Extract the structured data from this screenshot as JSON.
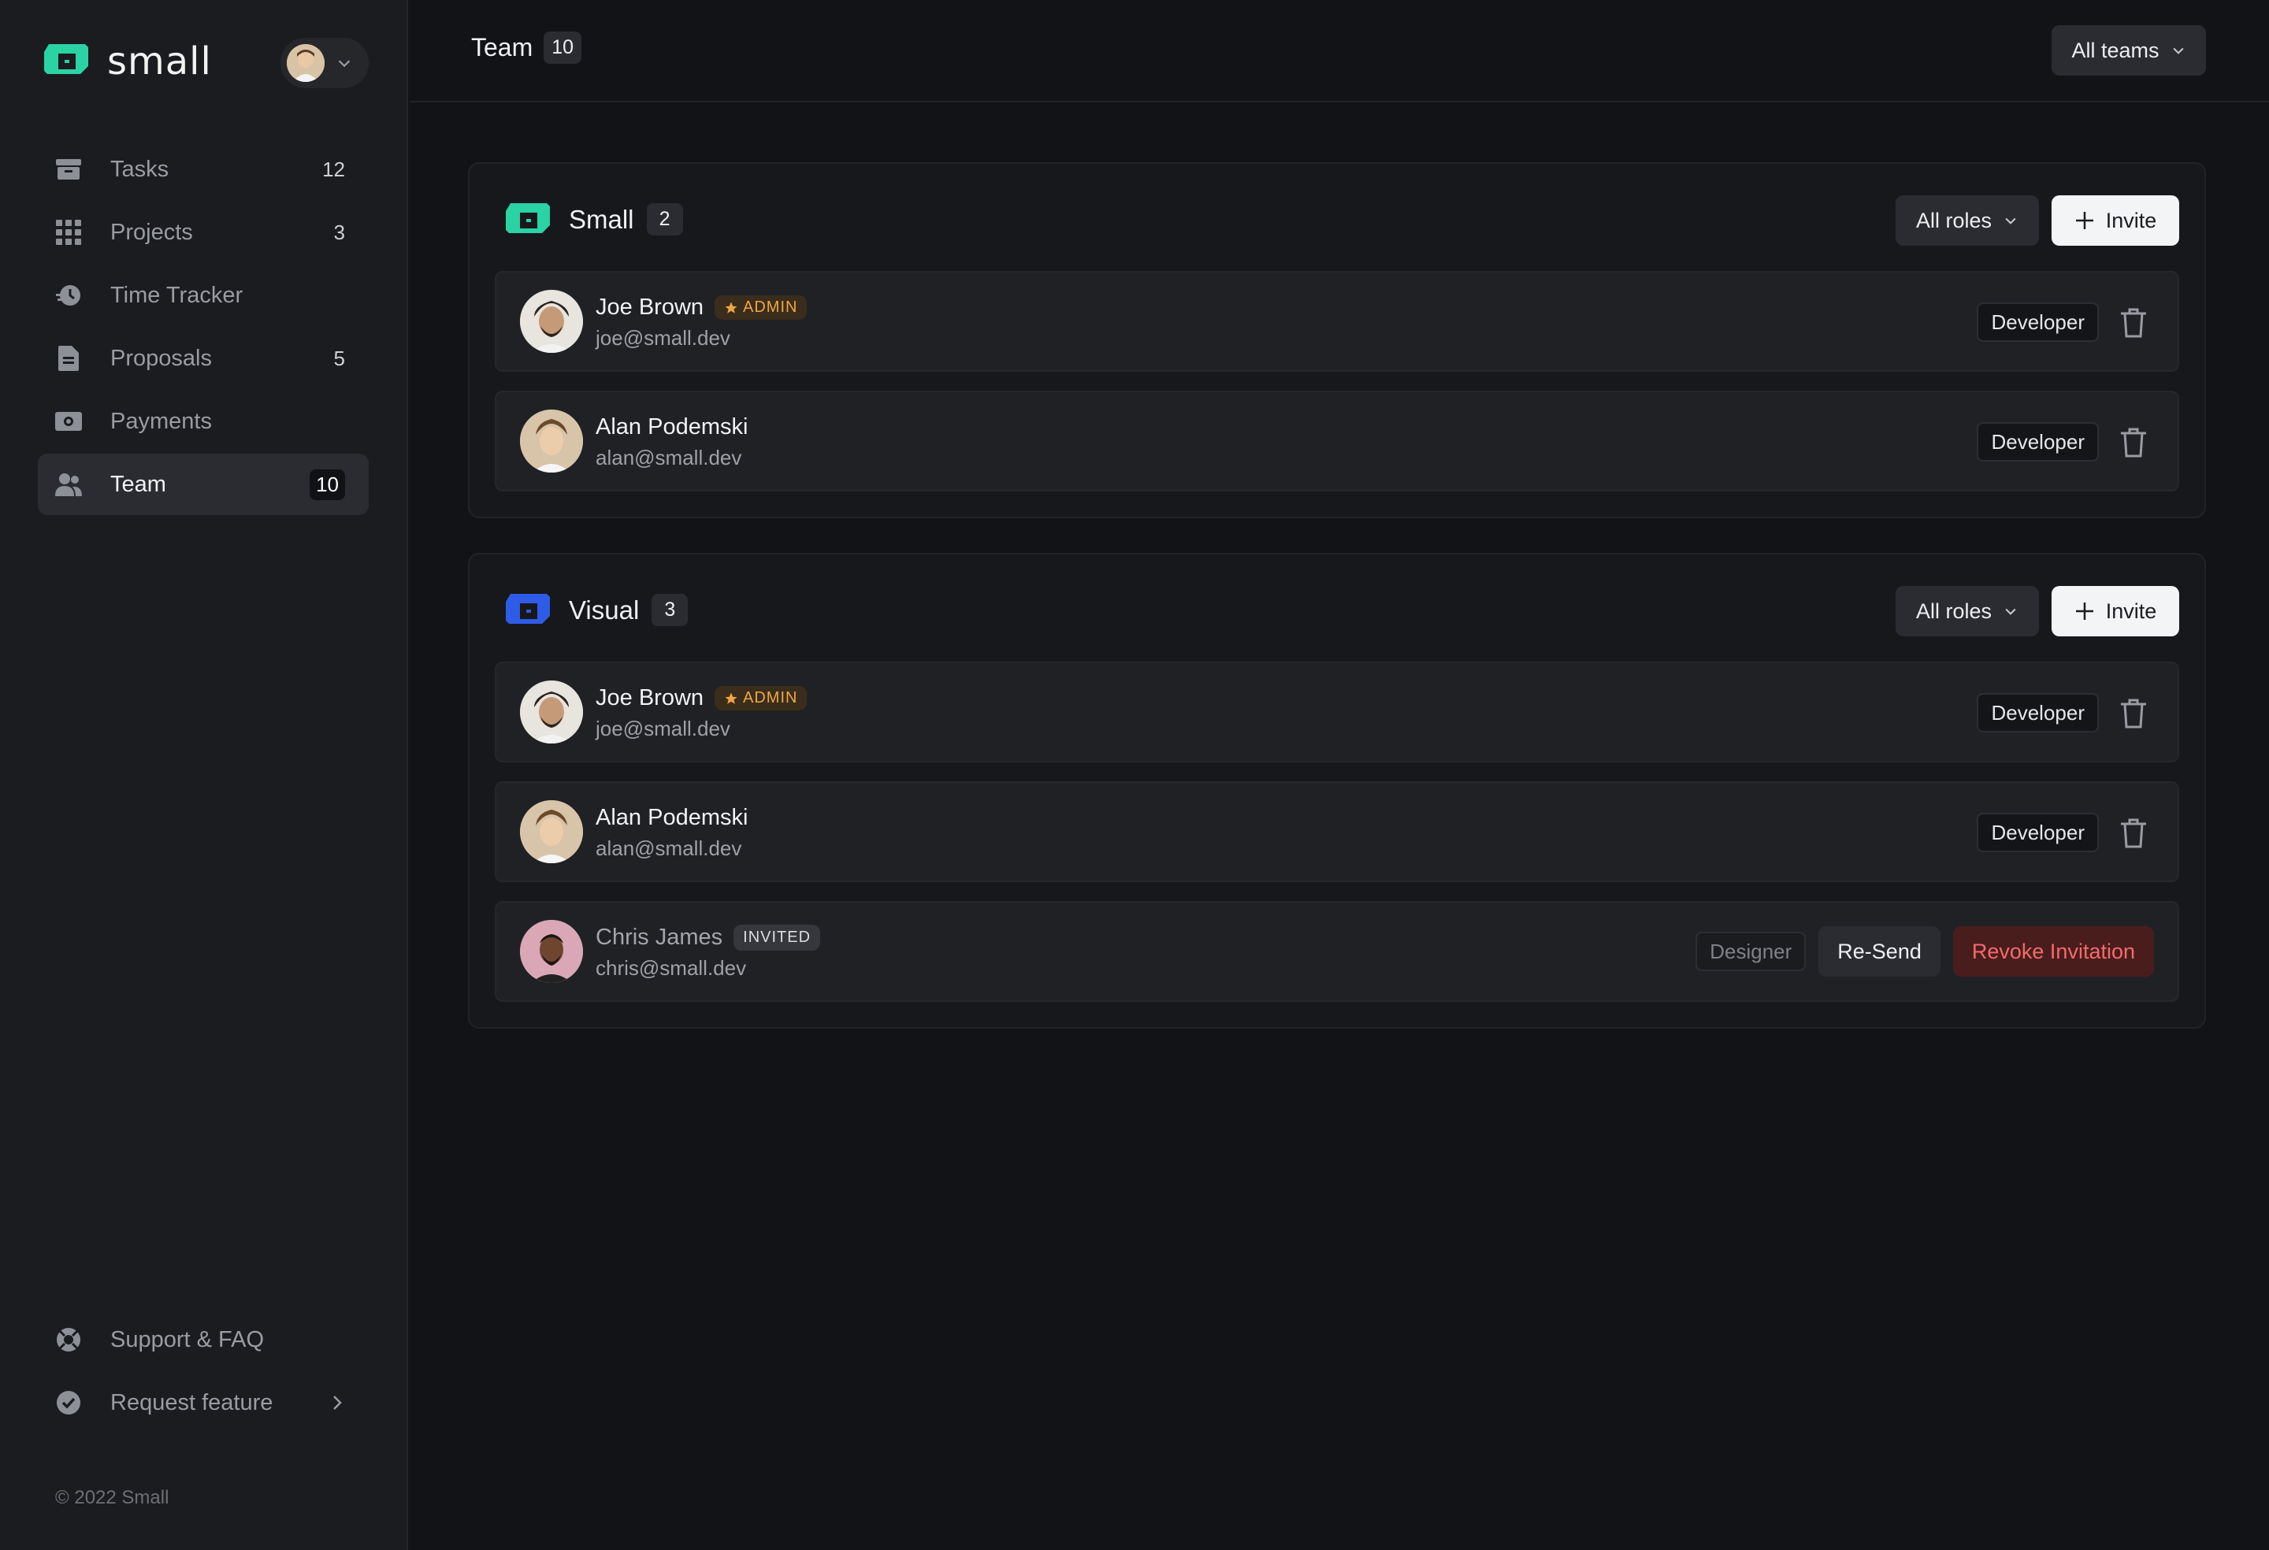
{
  "brand": {
    "name": "small",
    "accent": "#2ad2a4",
    "visual_accent": "#2e5ce6"
  },
  "sidebar": {
    "items": [
      {
        "label": "Tasks",
        "count": "12",
        "icon": "inbox-icon"
      },
      {
        "label": "Projects",
        "count": "3",
        "icon": "grid-icon"
      },
      {
        "label": "Time Tracker",
        "count": "",
        "icon": "clock-icon"
      },
      {
        "label": "Proposals",
        "count": "5",
        "icon": "document-icon"
      },
      {
        "label": "Payments",
        "count": "",
        "icon": "banknote-icon"
      },
      {
        "label": "Team",
        "count": "10",
        "icon": "users-icon",
        "active": true
      }
    ],
    "bottom": [
      {
        "label": "Support & FAQ",
        "icon": "lifebuoy-icon"
      },
      {
        "label": "Request feature",
        "icon": "check-badge-icon"
      }
    ],
    "footer": "© 2022 Small"
  },
  "header": {
    "title": "Team",
    "count": "10",
    "filter": "All teams"
  },
  "teams": [
    {
      "name": "Small",
      "count": "2",
      "roles_filter": "All roles",
      "invite_label": "Invite",
      "members": [
        {
          "name": "Joe Brown",
          "email": "joe@small.dev",
          "tag": "ADMIN",
          "role": "Developer"
        },
        {
          "name": "Alan Podemski",
          "email": "alan@small.dev",
          "tag": "",
          "role": "Developer"
        }
      ]
    },
    {
      "name": "Visual",
      "count": "3",
      "roles_filter": "All roles",
      "invite_label": "Invite",
      "members": [
        {
          "name": "Joe Brown",
          "email": "joe@small.dev",
          "tag": "ADMIN",
          "role": "Developer"
        },
        {
          "name": "Alan Podemski",
          "email": "alan@small.dev",
          "tag": "",
          "role": "Developer"
        },
        {
          "name": "Chris James",
          "email": "chris@small.dev",
          "tag": "INVITED",
          "role": "Designer",
          "resend_label": "Re-Send",
          "revoke_label": "Revoke Invitation"
        }
      ]
    }
  ]
}
